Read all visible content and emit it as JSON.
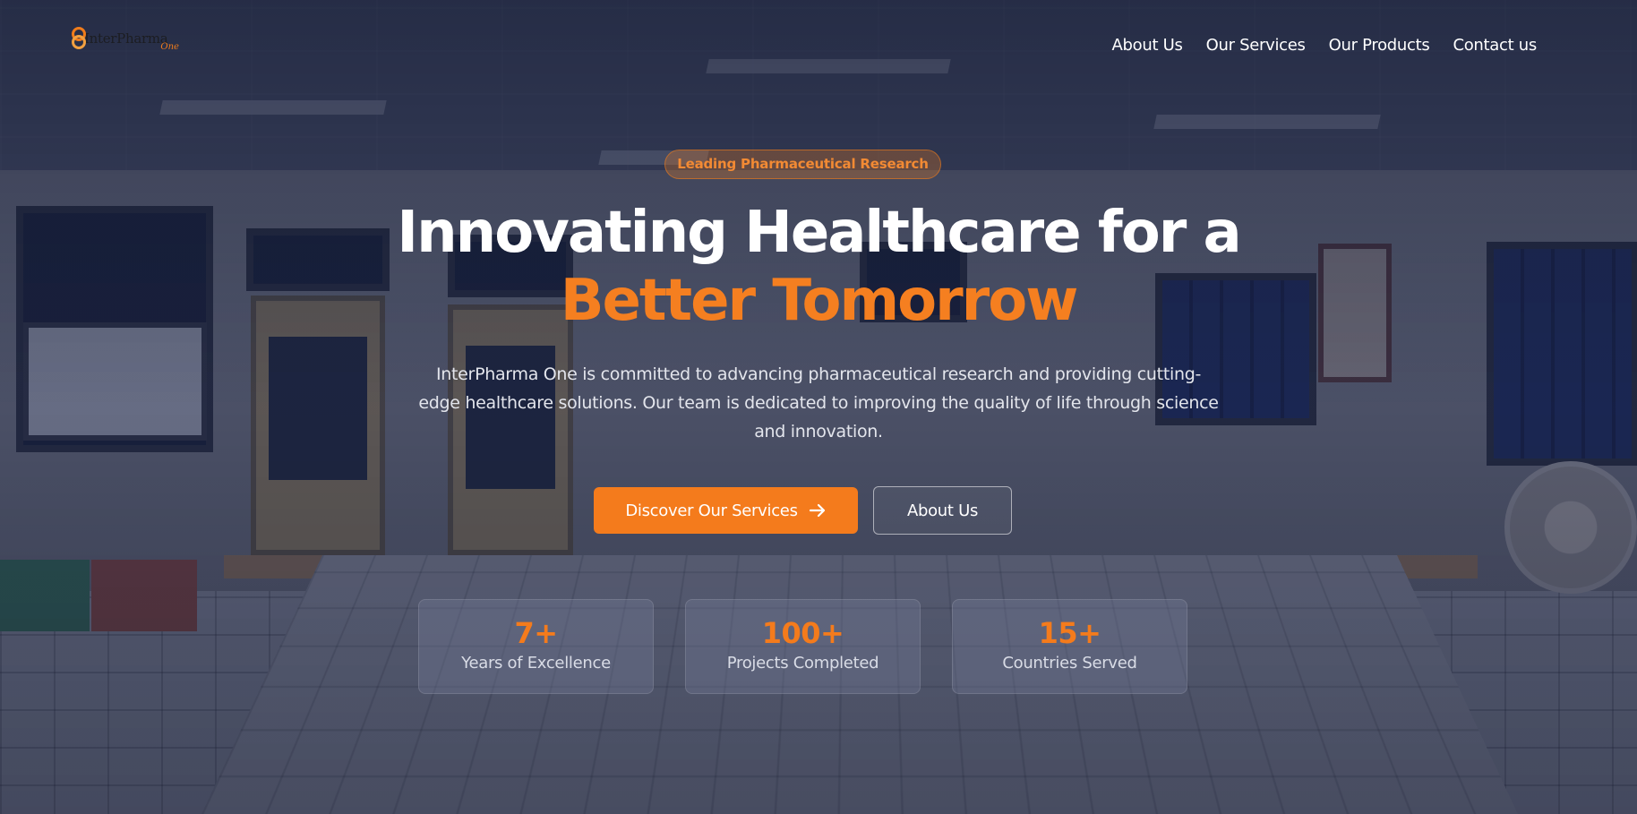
{
  "brand": {
    "name": "InterPharma",
    "sub": "One",
    "accent_color": "#f47b1c"
  },
  "nav": {
    "items": [
      {
        "label": "About Us"
      },
      {
        "label": "Our Services"
      },
      {
        "label": "Our Products"
      },
      {
        "label": "Contact us"
      }
    ]
  },
  "hero": {
    "badge": "Leading Pharmaceutical Research",
    "headline_line1": "Innovating Healthcare for a",
    "headline_line2": "Better Tomorrow",
    "description": "InterPharma One is committed to advancing pharmaceutical research and providing cutting-edge healthcare solutions. Our team is dedicated to improving the quality of life through science and innovation.",
    "primary_button": "Discover Our Services",
    "primary_button_icon": "arrow-right-icon",
    "secondary_button": "About Us"
  },
  "stats": [
    {
      "value": "7+",
      "label": "Years of Excellence"
    },
    {
      "value": "100+",
      "label": "Projects Completed"
    },
    {
      "value": "15+",
      "label": "Countries Served"
    }
  ]
}
